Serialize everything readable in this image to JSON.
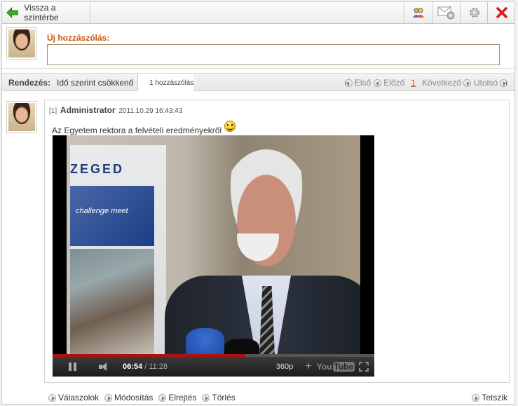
{
  "toolbar": {
    "back_label": "Vissza a színtérbe",
    "icons": [
      "back-arrow-icon",
      "users-icon",
      "mail-settings-icon",
      "settings-icon",
      "close-icon"
    ],
    "accent": "#2b9a2b",
    "close_color": "#d61a1a"
  },
  "new_comment": {
    "label": "Új hozzászólás:",
    "value": "",
    "label_color": "#c2560e"
  },
  "sort": {
    "label": "Rendezés:",
    "value": "Idő szerint csökkenő",
    "count": "1 hozzászólás"
  },
  "pager": {
    "first": "Első",
    "prev": "Előző",
    "current": "1",
    "next": "Következő",
    "last": "Utolsó"
  },
  "comment": {
    "index": "[1]",
    "author": "Administrator",
    "timestamp": "2011.10.29 16:43:43",
    "text": "Az Egyetem rektora a felvételi eredményekről",
    "emoticon": "smiley-icon",
    "video": {
      "banner_text": "ZEGED",
      "banner_slogan": "challenge meet",
      "current_time": "06:54",
      "separator": " / ",
      "duration": "11:28",
      "quality": "360p",
      "brand_you": "You",
      "brand_tube": "Tube",
      "progress_fraction": 0.6
    },
    "actions": {
      "reply": "Válaszolok",
      "edit": "Módosítás",
      "hide": "Elrejtés",
      "delete": "Törlés",
      "like": "Tetszik"
    }
  }
}
